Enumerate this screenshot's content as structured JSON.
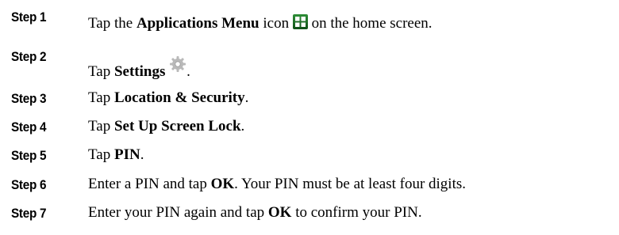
{
  "steps": [
    {
      "label": "Step 1",
      "parts": [
        {
          "t": "Tap the "
        },
        {
          "b": "Applications Menu"
        },
        {
          "t": " icon "
        },
        {
          "icon": "applications-menu-icon"
        },
        {
          "t": " on the home screen."
        }
      ]
    },
    {
      "label": "Step 2",
      "parts": [
        {
          "t": "Tap "
        },
        {
          "b": "Settings"
        },
        {
          "t": " "
        },
        {
          "icon": "settings-gear-icon"
        },
        {
          "t": "."
        }
      ]
    },
    {
      "label": "Step 3",
      "parts": [
        {
          "t": "Tap "
        },
        {
          "b": "Location & Security"
        },
        {
          "t": "."
        }
      ]
    },
    {
      "label": "Step 4",
      "parts": [
        {
          "t": "Tap "
        },
        {
          "b": "Set Up Screen Lock"
        },
        {
          "t": "."
        }
      ]
    },
    {
      "label": "Step 5",
      "parts": [
        {
          "t": "Tap "
        },
        {
          "b": "PIN"
        },
        {
          "t": "."
        }
      ]
    },
    {
      "label": "Step 6",
      "parts": [
        {
          "t": "Enter a PIN and tap "
        },
        {
          "b": "OK"
        },
        {
          "t": ". Your PIN must be at least four digits."
        }
      ]
    },
    {
      "label": "Step 7",
      "parts": [
        {
          "t": "Enter your PIN again and tap "
        },
        {
          "b": "OK"
        },
        {
          "t": " to confirm your PIN."
        }
      ]
    }
  ]
}
